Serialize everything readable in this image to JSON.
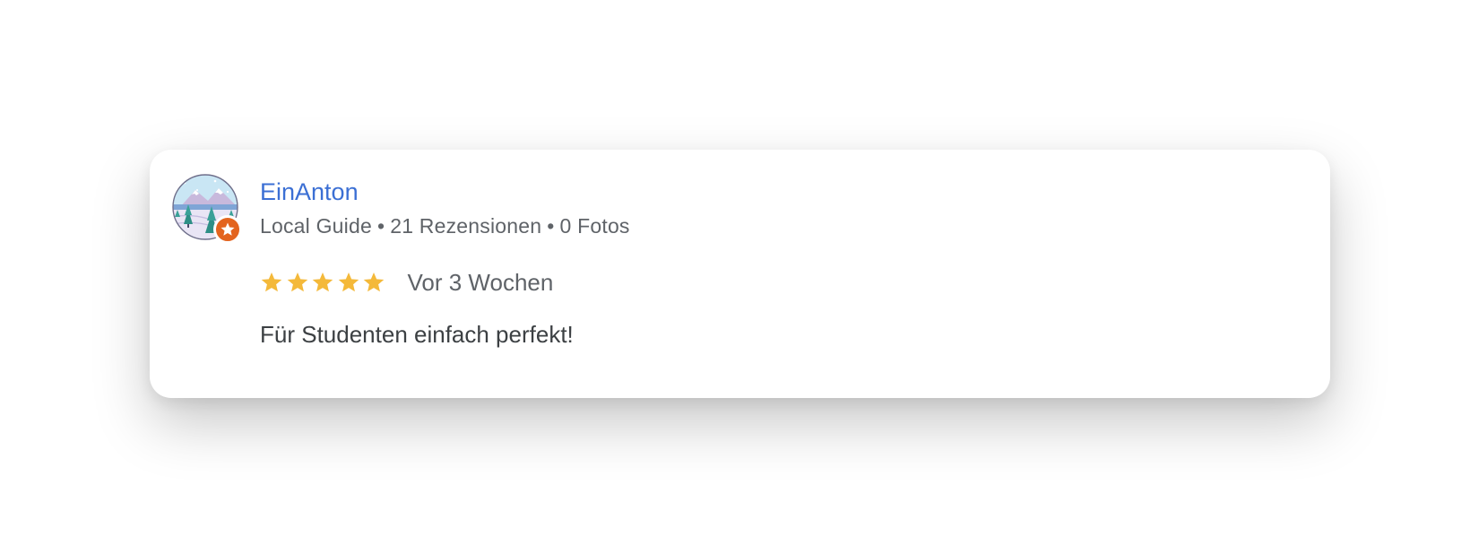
{
  "review": {
    "reviewer_name": "EinAnton",
    "reviewer_badge": "Local Guide",
    "review_count": "21 Rezensionen",
    "photo_count": "0 Fotos",
    "separator": "•",
    "rating": 5,
    "rating_max": 5,
    "date": "Vor 3 Wochen",
    "text": "Für Studenten einfach perfekt!"
  },
  "icons": {
    "avatar": "winter-landscape-avatar",
    "badge": "local-guide-star-badge-icon",
    "star": "star-icon"
  },
  "colors": {
    "name": "#3b6fd4",
    "meta": "#5f6368",
    "text": "#3c4043",
    "star": "#f4b93a",
    "badge": "#e3641f"
  }
}
